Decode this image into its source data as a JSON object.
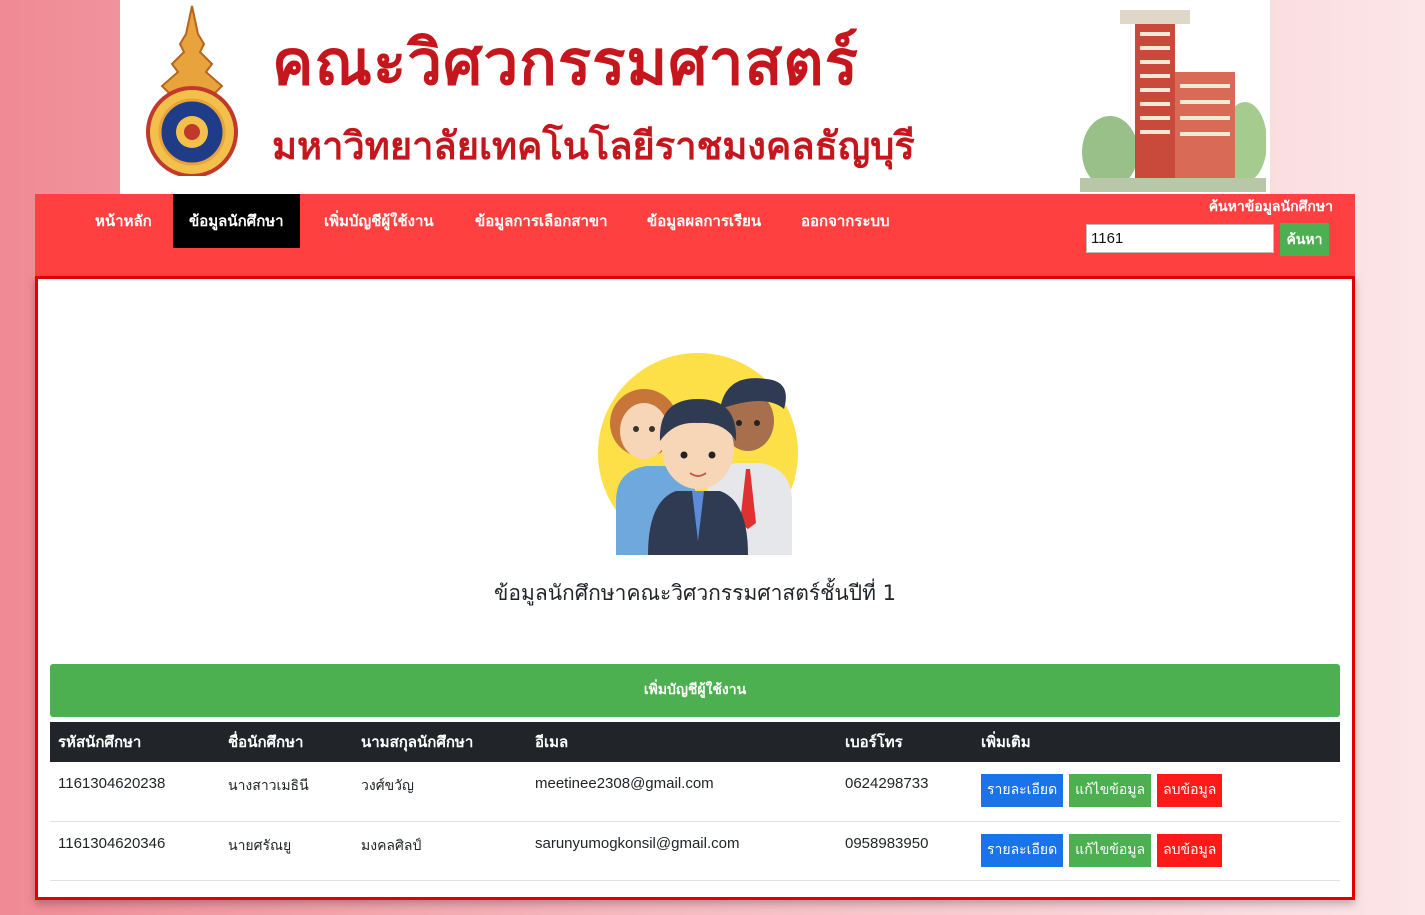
{
  "banner": {
    "line1": "คณะวิศวกรรมศาสตร์",
    "line2": "มหาวิทยาลัยเทคโนโลยีราชมงคลธัญบุรี",
    "brand_color": "#c4161c"
  },
  "nav": {
    "items": [
      {
        "label": "หน้าหลัก",
        "active": false
      },
      {
        "label": "ข้อมูลนักศึกษา",
        "active": true
      },
      {
        "label": "เพิ่มบัญชีผู้ใช้งาน",
        "active": false
      },
      {
        "label": "ข้อมูลการเลือกสาขา",
        "active": false
      },
      {
        "label": "ข้อมูลผลการเรียน",
        "active": false
      },
      {
        "label": "ออกจากระบบ",
        "active": false
      }
    ],
    "background": "#ff4040"
  },
  "search": {
    "label": "ค้นหาข้อมูลนักศึกษา",
    "value": "1161",
    "button": "ค้นหา"
  },
  "main": {
    "title": "ข้อมูลนักศึกษาคณะวิศวกรรมศาสตร์ชั้นปีที่ 1",
    "add_button": "เพิ่มบัญชีผู้ใช้งาน"
  },
  "table": {
    "headers": [
      "รหัสนักศึกษา",
      "ชื่อนักศึกษา",
      "นามสกุลนักศึกษา",
      "อีเมล",
      "เบอร์โทร",
      "เพิ่มเติม"
    ],
    "rows": [
      {
        "id": "1161304620238",
        "first": "นางสาวเมธินี",
        "last": "วงศ์ขวัญ",
        "email": "meetinee2308@gmail.com",
        "phone": "0624298733"
      },
      {
        "id": "1161304620346",
        "first": "นายศรัณยู",
        "last": "มงคลศิลป์",
        "email": "sarunyumogkonsil@gmail.com",
        "phone": "0958983950"
      }
    ],
    "actions": {
      "detail": "รายละเอียด",
      "edit": "แก้ไขข้อมูล",
      "delete": "ลบข้อมูล"
    }
  }
}
